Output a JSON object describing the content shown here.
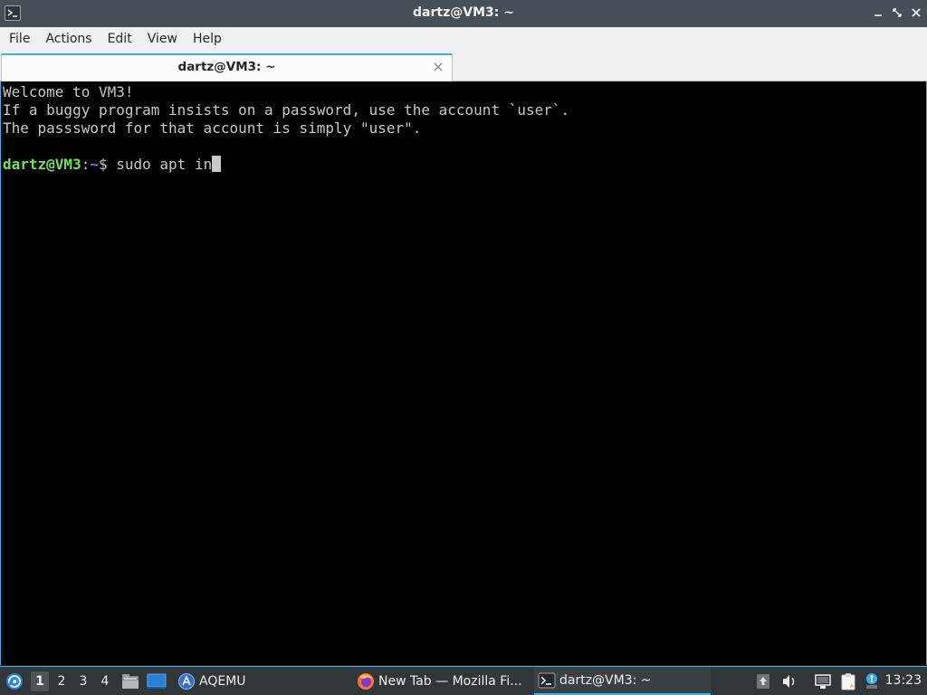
{
  "window": {
    "title": "dartz@VM3: ~"
  },
  "menu": {
    "items": [
      "File",
      "Actions",
      "Edit",
      "View",
      "Help"
    ]
  },
  "tabs": [
    {
      "label": "dartz@VM3: ~"
    }
  ],
  "terminal": {
    "lines": [
      "Welcome to VM3!",
      "If a buggy program insists on a password, use the account `user`.",
      "The passsword for that account is simply \"user\"."
    ],
    "prompt_user": "dartz@VM3",
    "prompt_colon": ":",
    "prompt_path": "~",
    "prompt_symbol": "$ ",
    "command": "sudo apt in"
  },
  "taskbar": {
    "desktops": [
      "1",
      "2",
      "3",
      "4"
    ],
    "active_desktop": "1",
    "launchers": [
      {
        "icon": "file-manager-icon"
      },
      {
        "icon": "show-desktop-icon"
      }
    ],
    "tasks": [
      {
        "label": "AQEMU",
        "icon": "aqemu-icon"
      },
      {
        "label": "New Tab — Mozilla Fi...",
        "icon": "firefox-icon"
      },
      {
        "label": "dartz@VM3: ~",
        "icon": "terminal-icon",
        "active": true
      }
    ],
    "tray": [
      "update-notifier-icon",
      "volume-icon",
      "network-icon",
      "clipboard-icon",
      "notification-icon"
    ],
    "clock": "13:23"
  },
  "colors": {
    "accent": "#3daee9",
    "prompt_user": "#6fe35a",
    "prompt_path": "#6a7fe8",
    "terminal_bg": "#000000",
    "terminal_fg": "#c8c8c8"
  }
}
